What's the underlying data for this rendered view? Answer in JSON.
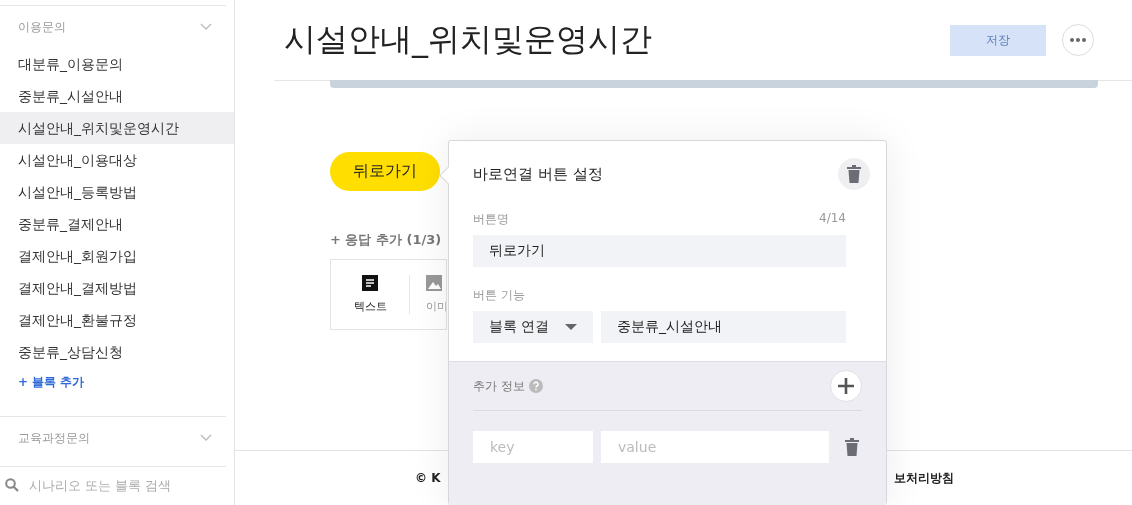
{
  "sidebar": {
    "groups": [
      {
        "title": "이용문의",
        "items": [
          {
            "label": "대분류_이용문의",
            "selected": false
          },
          {
            "label": "중분류_시설안내",
            "selected": false
          },
          {
            "label": "시설안내_위치및운영시간",
            "selected": true
          },
          {
            "label": "시설안내_이용대상",
            "selected": false
          },
          {
            "label": "시설안내_등록방법",
            "selected": false
          },
          {
            "label": "중분류_결제안내",
            "selected": false
          },
          {
            "label": "결제안내_회원가입",
            "selected": false
          },
          {
            "label": "결제안내_결제방법",
            "selected": false
          },
          {
            "label": "결제안내_환불규정",
            "selected": false
          },
          {
            "label": "중분류_상담신청",
            "selected": false
          }
        ],
        "add_link": "+ 블록 추가"
      },
      {
        "title": "교육과정문의"
      }
    ],
    "search": {
      "placeholder": "시나리오 또는 블록 검색"
    }
  },
  "header": {
    "title": "시설안내_위치및운영시간",
    "save_button": {
      "label": "저장",
      "disabled": true
    }
  },
  "quick_reply": {
    "label": "뒤로가기"
  },
  "add_response": {
    "label": "+ 응답 추가 (1/3)",
    "types": [
      {
        "label": "텍스트",
        "kind": "text"
      },
      {
        "label": "이미",
        "kind": "image"
      }
    ]
  },
  "popover": {
    "title": "바로연결 버튼 설정",
    "name_label": "버튼명",
    "name_count": "4/14",
    "name_value": "뒤로가기",
    "function_label": "버튼 기능",
    "function_type": "블록 연결",
    "function_target": "중분류_시설안내",
    "extra_label": "추가 정보",
    "key_placeholder": "key",
    "value_placeholder": "value"
  },
  "footer": {
    "left": "© K",
    "right": "보처리방침"
  }
}
